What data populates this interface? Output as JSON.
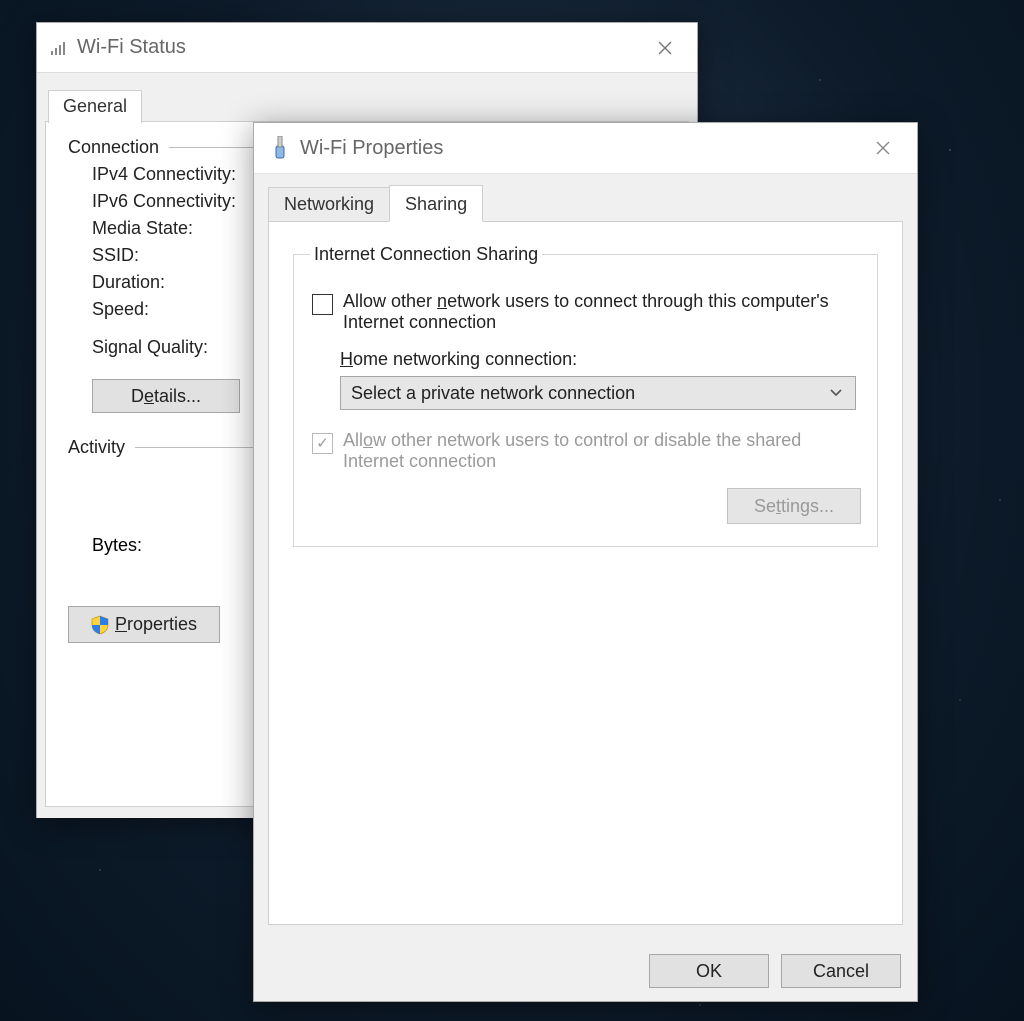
{
  "status_window": {
    "title": "Wi-Fi Status",
    "tab_general": "General",
    "section_connection": "Connection",
    "fields": {
      "ipv4": "IPv4 Connectivity:",
      "ipv6": "IPv6 Connectivity:",
      "media_state": "Media State:",
      "ssid": "SSID:",
      "duration": "Duration:",
      "speed": "Speed:",
      "signal_quality": "Signal Quality:"
    },
    "details_button": "Details...",
    "section_activity": "Activity",
    "bytes_label": "Bytes:",
    "properties_button": "Properties"
  },
  "props_window": {
    "title": "Wi-Fi Properties",
    "tabs": {
      "networking": "Networking",
      "sharing": "Sharing"
    },
    "group_title": "Internet Connection Sharing",
    "allow_connect_prefix": "Allow other ",
    "allow_connect_underlined": "n",
    "allow_connect_suffix": "etwork users to connect through this computer's Internet connection",
    "home_prefix": "",
    "home_underlined": "H",
    "home_suffix": "ome networking connection:",
    "home_select_value": "Select a private network connection",
    "allow_control_prefix": "All",
    "allow_control_underlined": "o",
    "allow_control_suffix": "w other network users to control or disable the shared Internet connection",
    "settings_button": "Settings...",
    "ok_button": "OK",
    "cancel_button": "Cancel"
  }
}
